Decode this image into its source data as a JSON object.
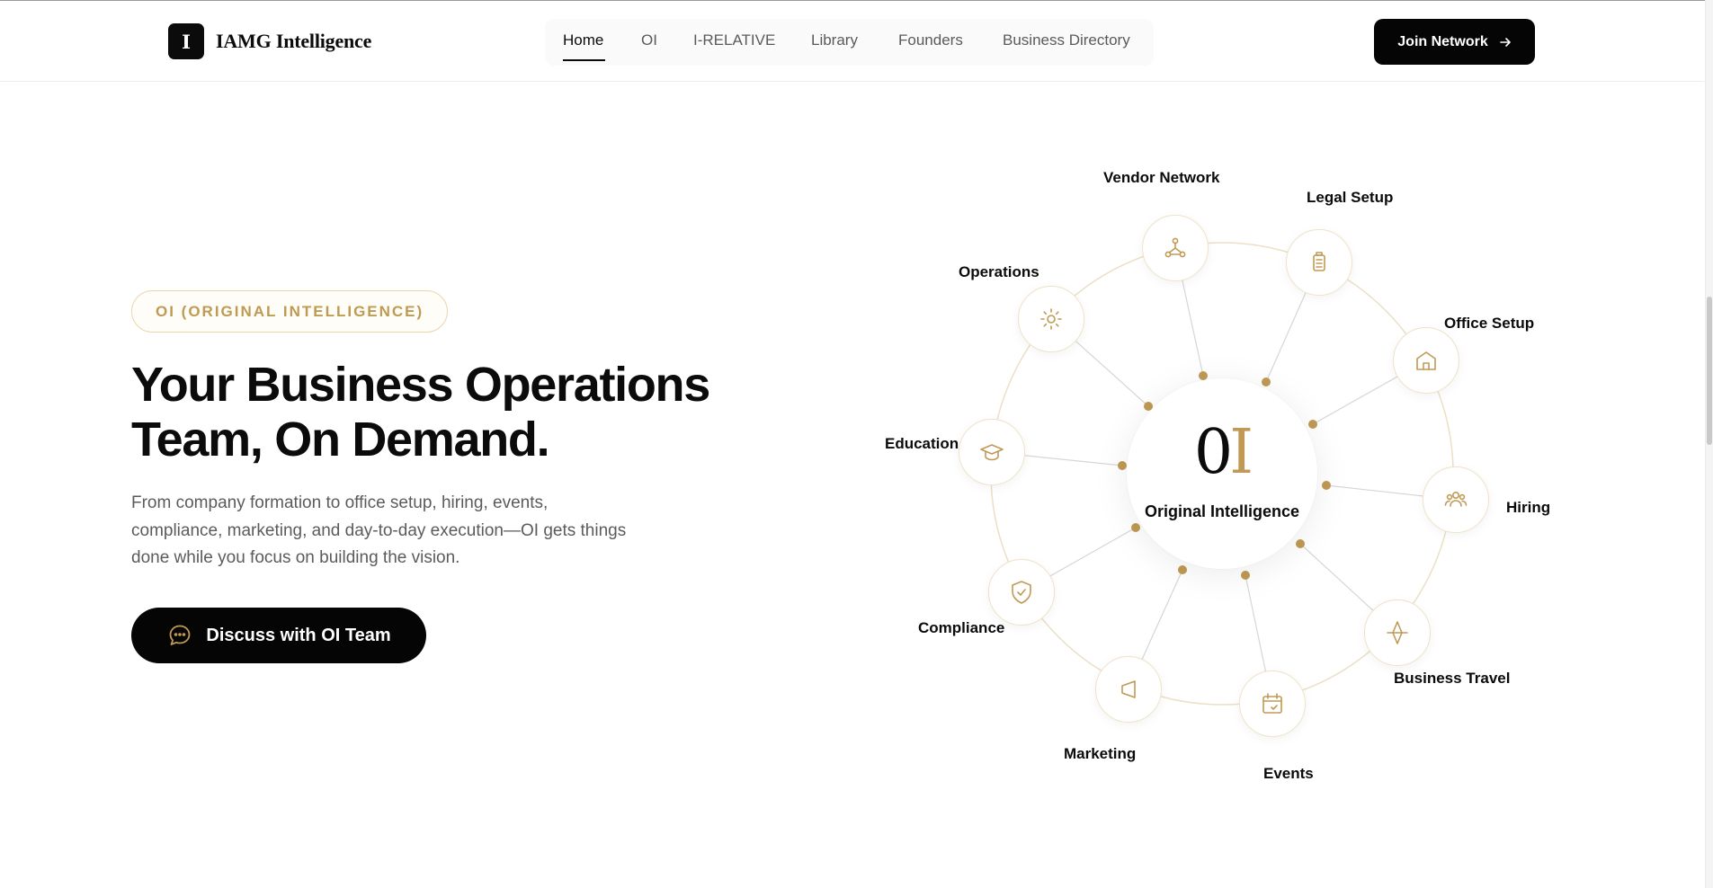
{
  "header": {
    "logo_letter": "I",
    "logo_text": "IAMG Intelligence",
    "nav": [
      "Home",
      "OI",
      "I-RELATIVE",
      "Library",
      "Founders",
      "Business Directory"
    ],
    "active_nav": "Home",
    "join_label": "Join Network",
    "join_icon": "arrow-right-icon"
  },
  "hero": {
    "badge": "OI (ORIGINAL INTELLIGENCE)",
    "headline_line1": "Your Business Operations",
    "headline_line2": "Team, On Demand.",
    "subtext": "From company formation to office setup, hiring, events, compliance, marketing, and day-to-day execution—OI gets things done while you focus on building the vision.",
    "cta_label": "Discuss with OI Team",
    "cta_icon": "chat-bubble-icon"
  },
  "diagram": {
    "center_logo_dark": "0",
    "center_logo_gold": "I",
    "center_label": "Original Intelligence",
    "nodes": [
      {
        "label": "Vendor Network",
        "icon": "network-icon"
      },
      {
        "label": "Legal Setup",
        "icon": "document-icon"
      },
      {
        "label": "Office Setup",
        "icon": "building-icon"
      },
      {
        "label": "Hiring",
        "icon": "people-icon"
      },
      {
        "label": "Business Travel",
        "icon": "plane-icon"
      },
      {
        "label": "Events",
        "icon": "calendar-icon"
      },
      {
        "label": "Marketing",
        "icon": "megaphone-icon"
      },
      {
        "label": "Compliance",
        "icon": "shield-check-icon"
      },
      {
        "label": "Education",
        "icon": "graduation-cap-icon"
      },
      {
        "label": "Operations",
        "icon": "gear-icon"
      }
    ]
  },
  "colors": {
    "accent_gold": "#c09a55",
    "dark": "#050505",
    "text_muted": "#5b5b5b",
    "ring": "#e8dcc4"
  }
}
